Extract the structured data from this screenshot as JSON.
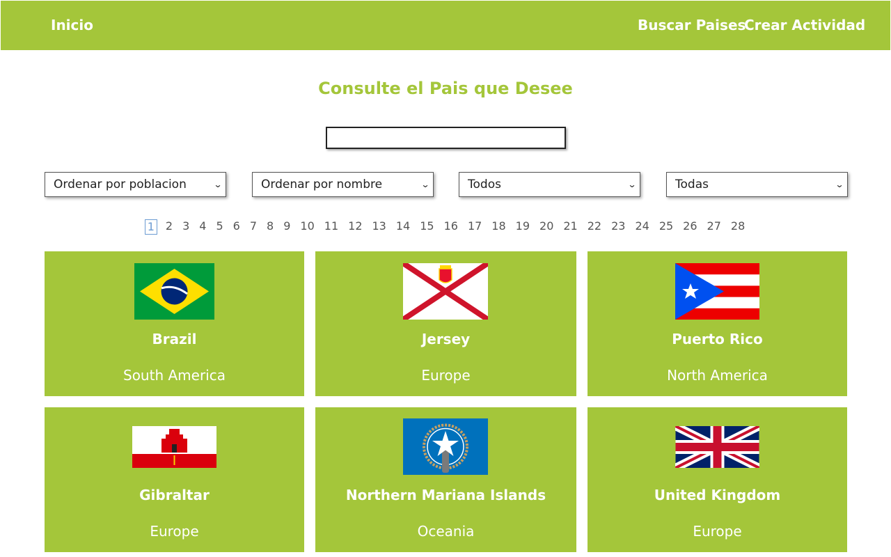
{
  "nav": {
    "home": "Inicio",
    "search_countries": "Buscar Paises",
    "create_activity": "Crear Actividad"
  },
  "page_title": "Consulte el Pais que Desee",
  "search": {
    "value": "",
    "placeholder": ""
  },
  "filters": {
    "population_sort": "Ordenar por poblacion",
    "name_sort": "Ordenar por nombre",
    "continent": "Todos",
    "activity": "Todas"
  },
  "pagination": {
    "current": "1",
    "pages": [
      "1",
      "2",
      "3",
      "4",
      "5",
      "6",
      "7",
      "8",
      "9",
      "10",
      "11",
      "12",
      "13",
      "14",
      "15",
      "16",
      "17",
      "18",
      "19",
      "20",
      "21",
      "22",
      "23",
      "24",
      "25",
      "26",
      "27",
      "28"
    ]
  },
  "countries": [
    {
      "name": "Brazil",
      "continent": "South America"
    },
    {
      "name": "Jersey",
      "continent": "Europe"
    },
    {
      "name": "Puerto Rico",
      "continent": "North America"
    },
    {
      "name": "Gibraltar",
      "continent": "Europe"
    },
    {
      "name": "Northern Mariana Islands",
      "continent": "Oceania"
    },
    {
      "name": "United Kingdom",
      "continent": "Europe"
    }
  ],
  "colors": {
    "accent": "#a4c63a",
    "text_on_accent": "#ffffff",
    "page_active": "#6b9bd2"
  }
}
